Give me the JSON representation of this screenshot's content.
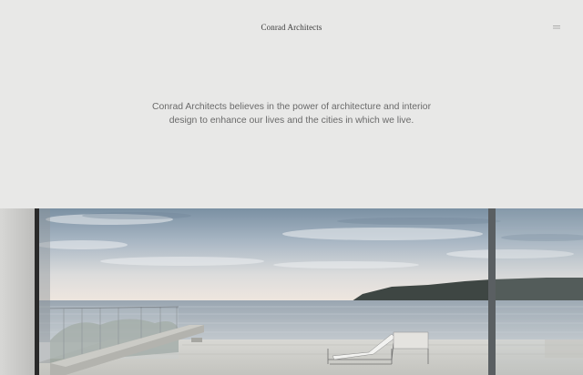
{
  "header": {
    "logo_text": "Conrad Architects",
    "menu_icon": "hamburger-icon"
  },
  "intro": {
    "mission_statement": "Conrad Architects believes in the power of architecture and interior design to enhance our lives and the cities in which we live."
  },
  "hero": {
    "subject": "ocean-view-terrace-photo",
    "colors": {
      "sky_top": "#7f95a8",
      "sky_horizon": "#efe6de",
      "sea": "#aab3bb",
      "headland": "#3c4441",
      "deck": "#cfcfca"
    }
  },
  "theme": {
    "background": "#e8e8e7",
    "text": "#6a6a6a",
    "logo": "#3c3c3c"
  }
}
